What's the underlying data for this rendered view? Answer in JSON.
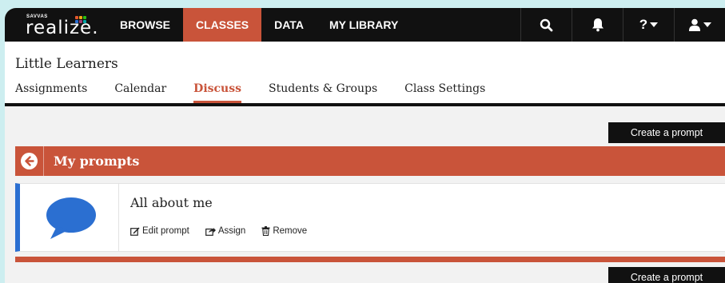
{
  "brand": {
    "small": "SAVVAS",
    "name": "realize.",
    "dot_colors": [
      "#e4572e",
      "#f3a712",
      "#29bf12",
      "#2b6fd1",
      "#a23b72",
      "#00a6a6"
    ]
  },
  "nav": {
    "items": [
      {
        "label": "BROWSE",
        "active": false
      },
      {
        "label": "CLASSES",
        "active": true
      },
      {
        "label": "DATA",
        "active": false
      },
      {
        "label": "MY LIBRARY",
        "active": false
      }
    ],
    "icons": [
      "search-icon",
      "bell-icon",
      "help-icon",
      "user-icon"
    ],
    "help_label": "?"
  },
  "class": {
    "title": "Little Learners",
    "tabs": [
      {
        "label": "Assignments",
        "active": false
      },
      {
        "label": "Calendar",
        "active": false
      },
      {
        "label": "Discuss",
        "active": true
      },
      {
        "label": "Students & Groups",
        "active": false
      },
      {
        "label": "Class Settings",
        "active": false
      }
    ]
  },
  "buttons": {
    "create_prompt": "Create a prompt"
  },
  "panel": {
    "title": "My prompts",
    "prompt": {
      "title": "All about me",
      "actions": {
        "edit": "Edit prompt",
        "assign": "Assign",
        "remove": "Remove"
      }
    }
  },
  "colors": {
    "accent": "#c9543a",
    "nav_bg": "#111111",
    "card_border": "#2b6fd1",
    "bubble": "#2b6fd1"
  }
}
